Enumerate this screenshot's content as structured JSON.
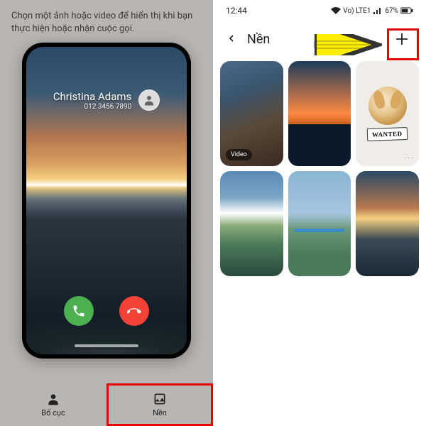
{
  "left": {
    "instruction": "Chọn một ảnh hoặc video để hiển thị khi bạn thực hiện hoặc nhận cuộc gọi.",
    "caller_name": "Christina Adams",
    "caller_number": "012 3456 7890",
    "tabs": {
      "layout": "Bố cục",
      "background": "Nền"
    }
  },
  "right": {
    "status": {
      "time": "12:44",
      "network": "Vo) LTE1",
      "battery": "67%"
    },
    "header": {
      "title": "Nền"
    },
    "thumbs": {
      "video_badge": "Video",
      "wanted_label": "WANTED",
      "dots": ". . ."
    }
  }
}
